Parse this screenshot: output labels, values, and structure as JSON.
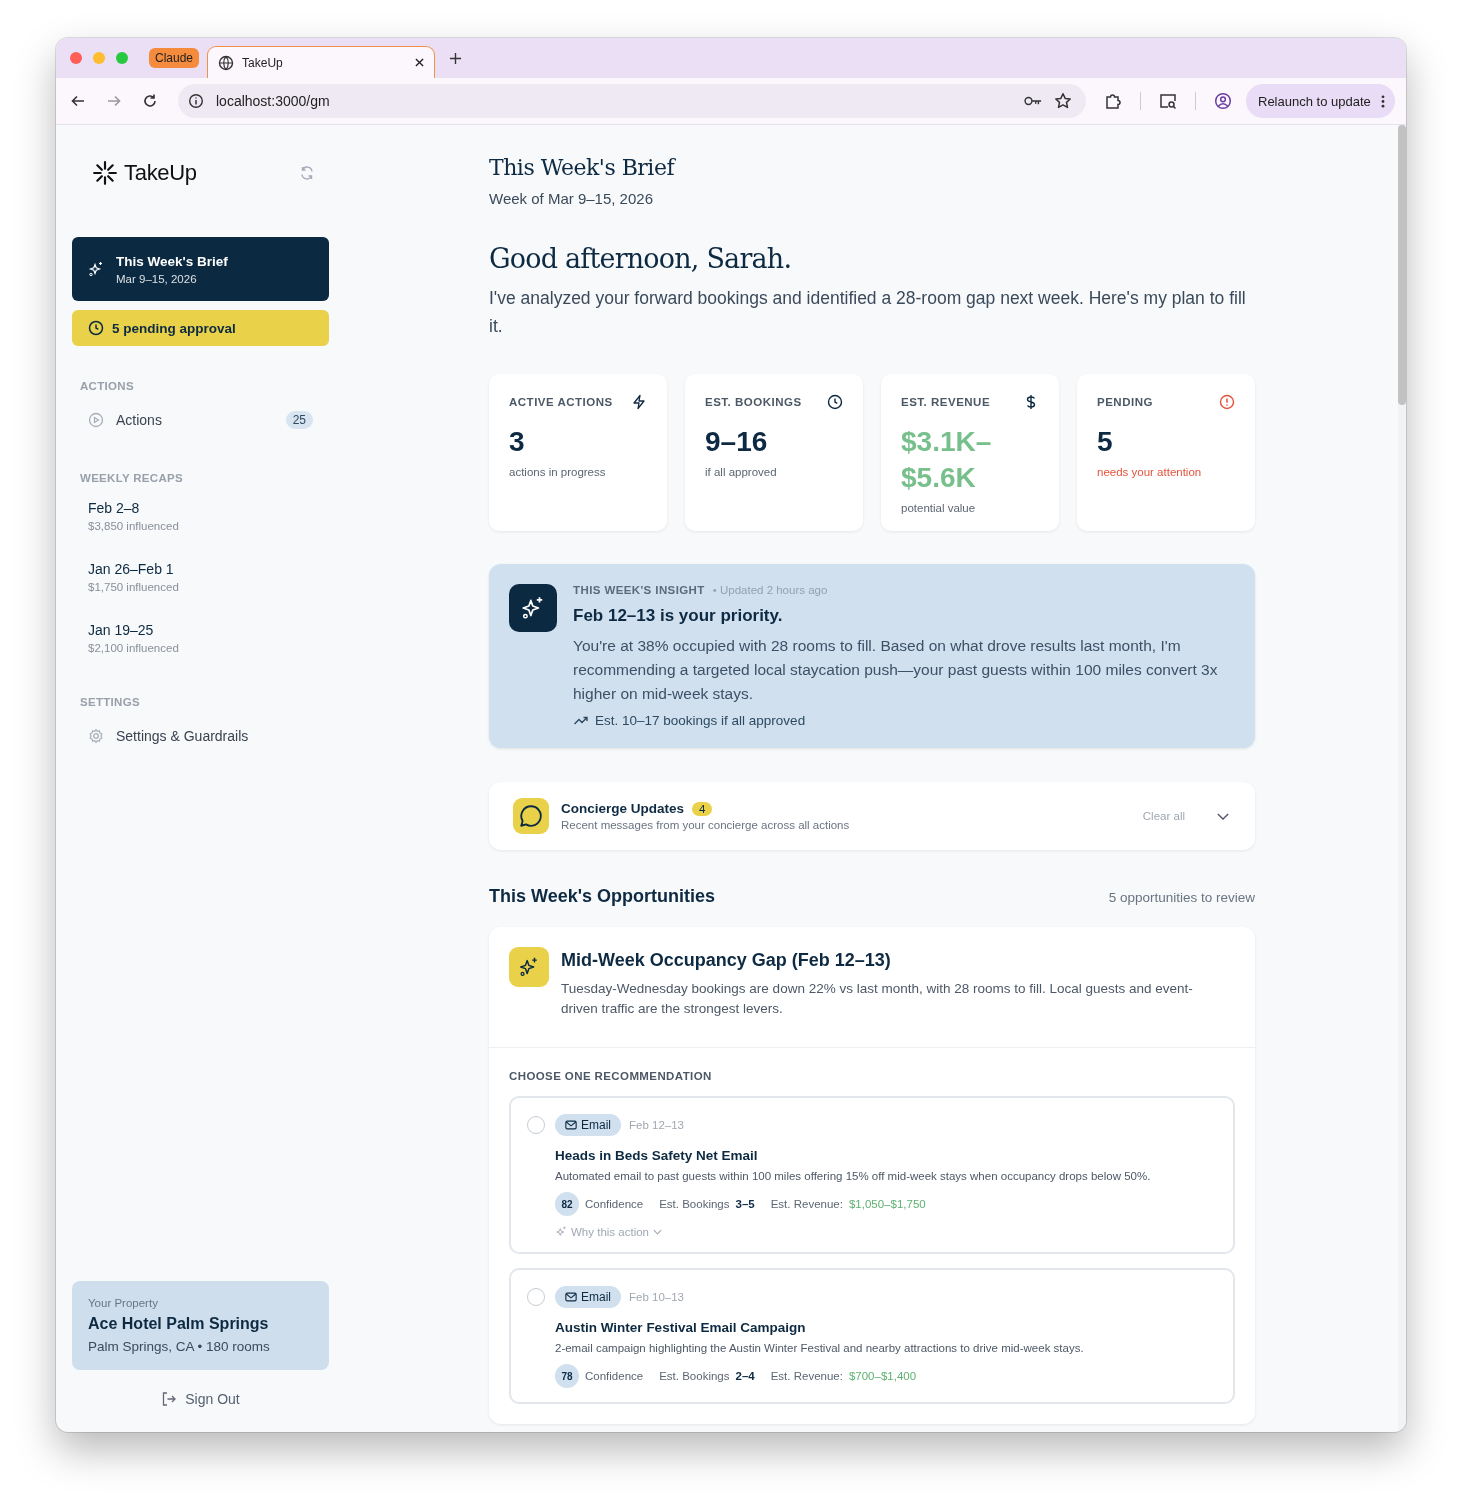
{
  "browser": {
    "tab_group": "Claude",
    "tab_title": "TakeUp",
    "address": "localhost:3000/gm",
    "relaunch_button": "Relaunch to update"
  },
  "sidebar": {
    "logo": "TakeUp",
    "brief": {
      "title": "This Week's Brief",
      "subtitle": "Mar 9–15, 2026",
      "selected": true
    },
    "pending_button": "5 pending approval",
    "sections": [
      {
        "heading": "ACTIONS",
        "items": [
          {
            "kind": "link",
            "label": "Actions",
            "count": "25"
          }
        ]
      },
      {
        "heading": "WEEKLY RECAPS",
        "items": [
          {
            "kind": "recap",
            "label": "Feb 2–8",
            "sub": "$3,850 influenced"
          },
          {
            "kind": "recap",
            "label": "Jan 26–Feb 1",
            "sub": "$1,750 influenced"
          },
          {
            "kind": "recap",
            "label": "Jan 19–25",
            "sub": "$2,100 influenced"
          }
        ]
      },
      {
        "heading": "SETTINGS",
        "items": [
          {
            "kind": "link",
            "label": "Settings & Guardrails"
          }
        ]
      }
    ],
    "property": {
      "label": "Your Property",
      "name": "Ace Hotel Palm Springs",
      "details": "Palm Springs, CA • 180 rooms"
    },
    "sign_out": "Sign Out"
  },
  "main": {
    "title": "This Week's Brief",
    "week": "Week of Mar 9–15, 2026",
    "greeting": "Good afternoon, Sarah.",
    "intro": "I've analyzed your forward bookings and identified a 28-room gap next week. Here's my plan to fill it.",
    "stats": [
      {
        "label": "ACTIVE ACTIONS",
        "value": "3",
        "caption": "actions in progress",
        "kind": "plain"
      },
      {
        "label": "EST. BOOKINGS",
        "value": "9–16",
        "caption": "if all approved",
        "kind": "plain"
      },
      {
        "label": "EST. REVENUE",
        "value": "$3.1K–$5.6K",
        "caption": "potential value",
        "kind": "revenue"
      },
      {
        "label": "PENDING",
        "value": "5",
        "caption": "needs your attention",
        "kind": "alert"
      }
    ],
    "insight": {
      "label": "THIS WEEK'S INSIGHT",
      "updated": "• Updated 2 hours ago",
      "title": "Feb 12–13 is your priority.",
      "body": "You're at 38% occupied with 28 rooms to fill. Based on what drove results last month, I'm recommending a targeted local staycation push—your past guests within 100 miles convert 3x higher on mid-week stays.",
      "estimate": "Est. 10–17 bookings if all approved"
    },
    "concierge": {
      "title": "Concierge Updates",
      "count": "4",
      "subtitle": "Recent messages from your concierge across all actions",
      "clear": "Clear all",
      "expanded": false
    },
    "opportunities": {
      "heading": "This Week's Opportunities",
      "count_text": "5 opportunities to review",
      "card": {
        "title": "Mid-Week Occupancy Gap (Feb 12–13)",
        "body": "Tuesday-Wednesday bookings are down 22% vs last month, with 28 rooms to fill. Local guests and event-driven traffic are the strongest levers.",
        "choose_label": "CHOOSE ONE RECOMMENDATION",
        "options": [
          {
            "selected": false,
            "channel": "Email",
            "dates": "Feb 12–13",
            "title": "Heads in Beds Safety Net Email",
            "description": "Automated email to past guests within 100 miles offering 15% off mid-week stays when occupancy drops below 50%.",
            "confidence": "82",
            "confidence_label": "Confidence",
            "bookings_label": "Est. Bookings",
            "bookings": "3–5",
            "revenue_label": "Est. Revenue:",
            "revenue": "$1,050–$1,750",
            "why": "Why this action"
          },
          {
            "selected": false,
            "channel": "Email",
            "dates": "Feb 10–13",
            "title": "Austin Winter Festival Email Campaign",
            "description": "2-email campaign highlighting the Austin Winter Festival and nearby attractions to drive mid-week stays.",
            "confidence": "78",
            "confidence_label": "Confidence",
            "bookings_label": "Est. Bookings",
            "bookings": "2–4",
            "revenue_label": "Est. Revenue:",
            "revenue": "$700–$1,400"
          }
        ]
      }
    }
  }
}
